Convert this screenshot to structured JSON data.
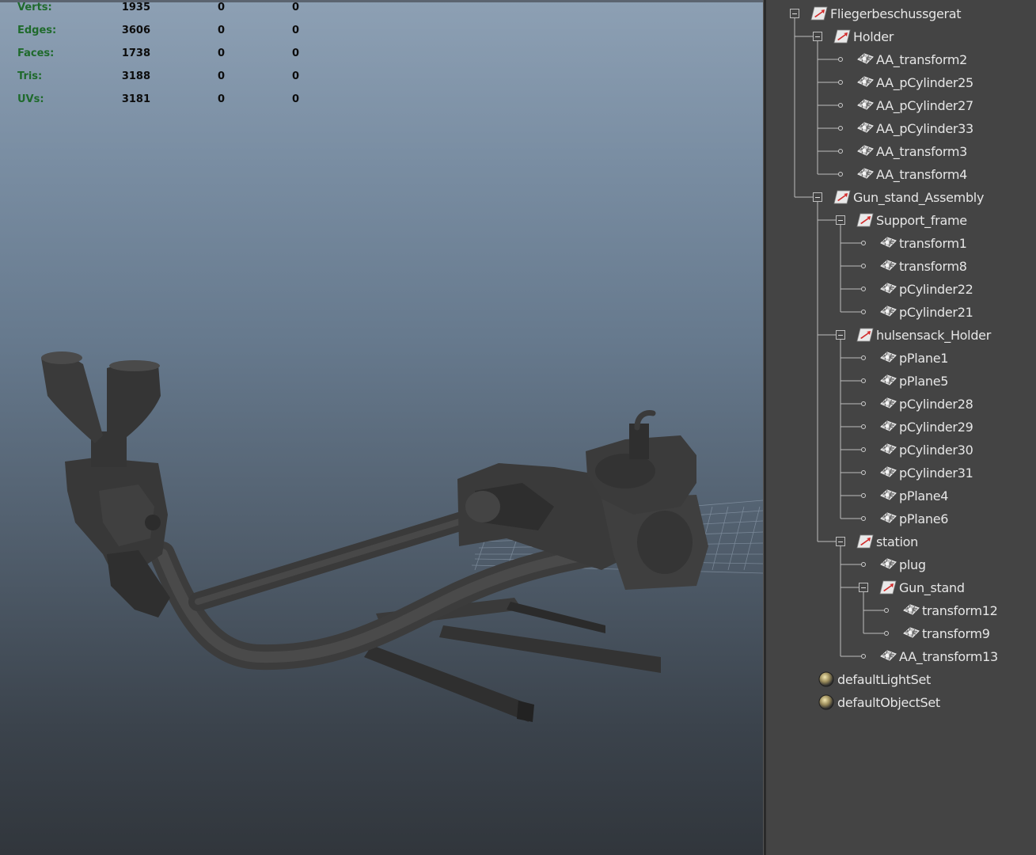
{
  "viewport": {
    "hud": [
      {
        "label": "Verts:",
        "values": [
          "1935",
          "0",
          "0"
        ]
      },
      {
        "label": "Edges:",
        "values": [
          "3606",
          "0",
          "0"
        ]
      },
      {
        "label": "Faces:",
        "values": [
          "1738",
          "0",
          "0"
        ]
      },
      {
        "label": "Tris:",
        "values": [
          "3188",
          "0",
          "0"
        ]
      },
      {
        "label": "UVs:",
        "values": [
          "3181",
          "0",
          "0"
        ]
      }
    ]
  },
  "outliner": {
    "nodes": [
      {
        "label": "Fliegerbeschussgerat",
        "icon": "transform-group-icon"
      },
      {
        "label": "Holder",
        "icon": "transform-group-icon"
      },
      {
        "label": "AA_transform2",
        "icon": "mesh-icon"
      },
      {
        "label": "AA_pCylinder25",
        "icon": "mesh-icon"
      },
      {
        "label": "AA_pCylinder27",
        "icon": "mesh-icon"
      },
      {
        "label": "AA_pCylinder33",
        "icon": "mesh-icon"
      },
      {
        "label": "AA_transform3",
        "icon": "mesh-icon"
      },
      {
        "label": "AA_transform4",
        "icon": "mesh-icon"
      },
      {
        "label": "Gun_stand_Assembly",
        "icon": "transform-group-icon"
      },
      {
        "label": "Support_frame",
        "icon": "transform-group-icon"
      },
      {
        "label": "transform1",
        "icon": "mesh-icon"
      },
      {
        "label": "transform8",
        "icon": "mesh-icon"
      },
      {
        "label": "pCylinder22",
        "icon": "mesh-icon"
      },
      {
        "label": "pCylinder21",
        "icon": "mesh-icon"
      },
      {
        "label": "hulsensack_Holder",
        "icon": "transform-group-icon"
      },
      {
        "label": "pPlane1",
        "icon": "mesh-icon"
      },
      {
        "label": "pPlane5",
        "icon": "mesh-icon"
      },
      {
        "label": "pCylinder28",
        "icon": "mesh-icon"
      },
      {
        "label": "pCylinder29",
        "icon": "mesh-icon"
      },
      {
        "label": "pCylinder30",
        "icon": "mesh-icon"
      },
      {
        "label": "pCylinder31",
        "icon": "mesh-icon"
      },
      {
        "label": "pPlane4",
        "icon": "mesh-icon"
      },
      {
        "label": "pPlane6",
        "icon": "mesh-icon"
      },
      {
        "label": "station",
        "icon": "transform-group-icon"
      },
      {
        "label": "plug",
        "icon": "mesh-icon"
      },
      {
        "label": "Gun_stand",
        "icon": "transform-group-icon"
      },
      {
        "label": "transform12",
        "icon": "mesh-icon"
      },
      {
        "label": "transform9",
        "icon": "mesh-icon"
      },
      {
        "label": "AA_transform13",
        "icon": "mesh-icon"
      },
      {
        "label": "defaultLightSet",
        "icon": "object-set-icon"
      },
      {
        "label": "defaultObjectSet",
        "icon": "object-set-icon"
      }
    ]
  },
  "colors": {
    "hud_label": "#1f6a2c",
    "hud_value": "#0c0c0c",
    "outliner_bg": "#444444",
    "outliner_text": "#e6e6e6",
    "mesh_dark": "#3d3d3d"
  }
}
